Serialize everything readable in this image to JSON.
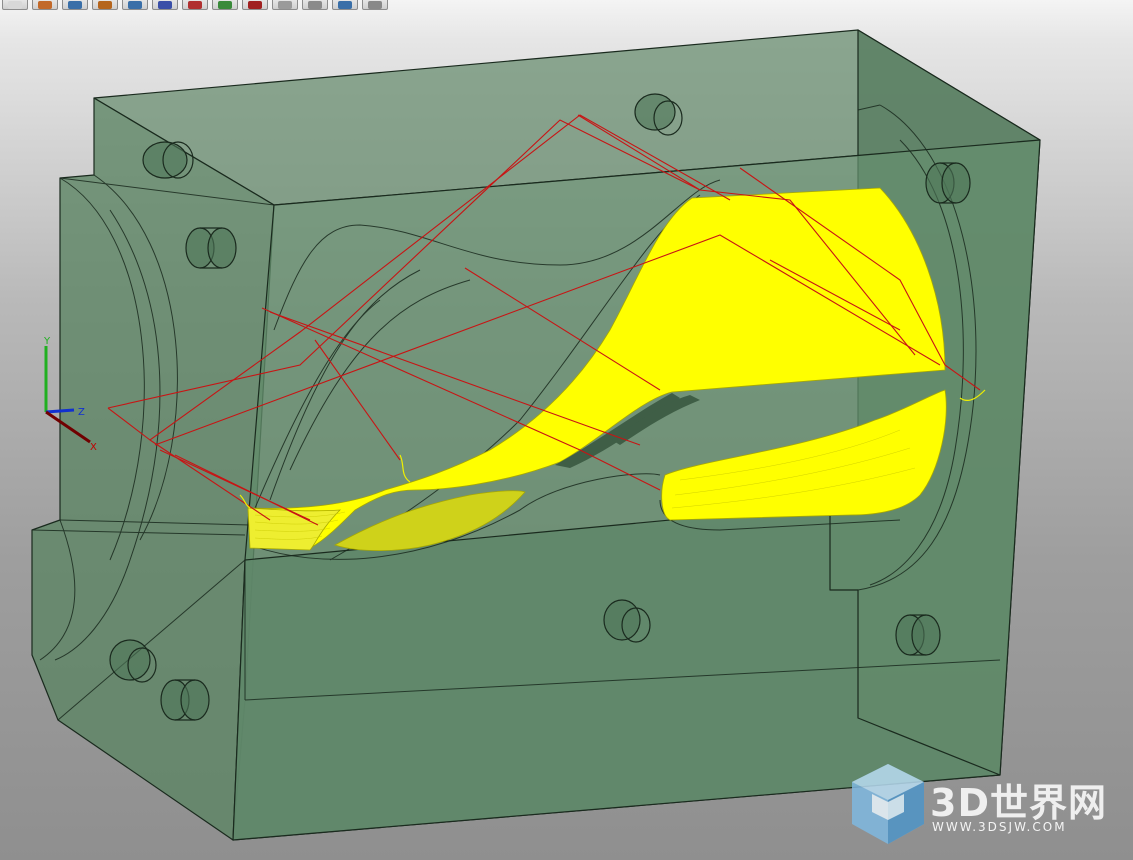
{
  "toolbar": {
    "buttons": [
      {
        "icon": "sheet-icon",
        "color": "#d8d8d8"
      },
      {
        "icon": "block-icon",
        "color": "#c2692a"
      },
      {
        "icon": "boundary-icon",
        "color": "#3a6fa8"
      },
      {
        "icon": "pattern-icon",
        "color": "#b5651d"
      },
      {
        "icon": "toolpath-icon",
        "color": "#3a6fa8"
      },
      {
        "icon": "leads-icon",
        "color": "#3a4fa8"
      },
      {
        "icon": "curve-edit-icon",
        "color": "#b03030"
      },
      {
        "icon": "verify-icon",
        "color": "#3a8a3a"
      },
      {
        "icon": "simulate-icon",
        "color": "#a02020"
      },
      {
        "icon": "arrow-icon",
        "color": "#9a9a9a"
      },
      {
        "icon": "ncprogram-icon",
        "color": "#8a8a8a"
      },
      {
        "icon": "viewcube-icon",
        "color": "#3a6fa8"
      },
      {
        "icon": "info-icon",
        "color": "#888888"
      }
    ]
  },
  "axes": {
    "x_label": "X",
    "y_label": "Y",
    "z_label": "Z",
    "x_color": "#c00000",
    "y_color": "#20b020",
    "z_color": "#1030d0"
  },
  "model": {
    "block_color": "#5e8a66",
    "edge_color": "#1a2a1e",
    "toolpath_color": "#ffff00",
    "link_color": "#c81414"
  },
  "watermark": {
    "title": "3D世界网",
    "url": "WWW.3DSJW.COM",
    "icon": "cube-logo-icon"
  }
}
